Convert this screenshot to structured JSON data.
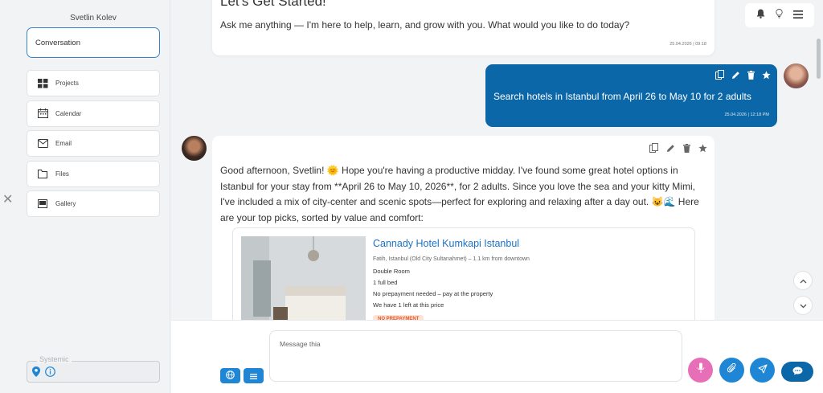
{
  "sidebar": {
    "user_name": "Svetlin Kolev",
    "conversation_label": "Conversation",
    "items": [
      {
        "label": "Projects",
        "icon": "grid-icon"
      },
      {
        "label": "Calendar",
        "icon": "calendar-icon"
      },
      {
        "label": "Email",
        "icon": "mail-icon"
      },
      {
        "label": "Files",
        "icon": "folder-icon"
      },
      {
        "label": "Gallery",
        "icon": "image-icon"
      }
    ],
    "systemic_label": "Systemic"
  },
  "top_icons": [
    "bell-icon",
    "lightbulb-icon",
    "menu-icon"
  ],
  "messages": {
    "greeting": {
      "title": "Let's Get Started!",
      "text": "Ask me anything — I'm here to help, learn, and grow with you. What would you like to do today?",
      "time": "25.04.2026 | 09:18"
    },
    "user": {
      "text": "Search hotels in Istanbul from April 26 to May 10 for 2 adults",
      "time": "25.04.2026 | 12:18 PM"
    },
    "bot": {
      "text": "Good afternoon, Svetlin! 🌞 Hope you're having a productive midday. I've found some great hotel options in Istanbul for your stay from **April 26 to May 10, 2026**, for 2 adults. Since you love the sea and your kitty Mimi, I've included a mix of city-center and scenic spots—perfect for exploring and relaxing after a day out. 😺🌊 Here are your top picks, sorted by value and comfort:"
    }
  },
  "hotel": {
    "name": "Cannady Hotel Kumkapi Istanbul",
    "location": "Fatih, Istanbul (Old City Sultanahmet) – 1.1 km from downtown",
    "room": "Double Room",
    "bed": "1 full bed",
    "payment": "No prepayment needed – pay at the property",
    "availability": "We have 1 left at this price",
    "badge": "NO PREPAYMENT"
  },
  "input": {
    "placeholder": "Message thia"
  },
  "colors": {
    "accent": "#0b67a8",
    "link": "#1a73c9",
    "mic": "#e66fb8",
    "action_blue": "#1f86d6"
  }
}
